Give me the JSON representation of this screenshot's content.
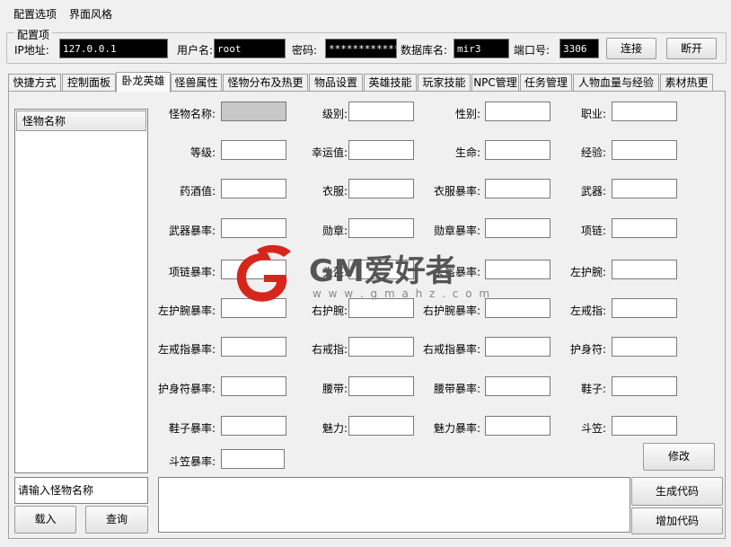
{
  "menu": {
    "config_options": "配置选项",
    "ui_style": "界面风格"
  },
  "config_group": {
    "title": "配置项",
    "ip_label": "IP地址:",
    "ip_value": "127.0.0.1",
    "user_label": "用户名:",
    "user_value": "root",
    "password_label": "密码:",
    "password_value": "**************",
    "db_label": "数据库名:",
    "db_value": "mir3",
    "port_label": "端口号:",
    "port_value": "3306",
    "connect": "连接",
    "disconnect": "断开"
  },
  "tabs": [
    "快捷方式",
    "控制面板",
    "卧龙英雄",
    "怪兽属性",
    "怪物分布及热更",
    "物品设置",
    "英雄技能",
    "玩家技能",
    "NPC管理",
    "任务管理",
    "人物血量与经验",
    "素材热更"
  ],
  "active_tab": 2,
  "list": {
    "header": "怪物名称",
    "search_placeholder": "请输入怪物名称",
    "load": "载入",
    "query": "查询"
  },
  "fields": {
    "name": "怪物名称:",
    "level": "级别:",
    "gender": "性别:",
    "job": "职业:",
    "grade": "等级:",
    "luck": "幸运值:",
    "hp": "生命:",
    "exp": "经验:",
    "wine": "药酒值:",
    "clothes": "衣服:",
    "clothes_rate": "衣服暴率:",
    "weapon": "武器:",
    "weapon_rate": "武器暴率:",
    "medal": "勋章:",
    "medal_rate": "勋章暴率:",
    "necklace": "项链:",
    "necklace_rate": "项链暴率:",
    "helmet": "头盔:",
    "helmet_rate": "头盔暴率:",
    "lbracelet": "左护腕:",
    "lbracelet_rate": "左护腕暴率:",
    "rbracelet": "右护腕:",
    "rbracelet_rate": "右护腕暴率:",
    "lring": "左戒指:",
    "lring_rate": "左戒指暴率:",
    "rring": "右戒指:",
    "rring_rate": "右戒指暴率:",
    "amulet": "护身符:",
    "amulet_rate": "护身符暴率:",
    "belt": "腰带:",
    "belt_rate": "腰带暴率:",
    "shoes": "鞋子:",
    "shoes_rate": "鞋子暴率:",
    "charm": "魅力:",
    "charm_rate": "魅力暴率:",
    "hat": "斗笠:",
    "hat_rate": "斗笠暴率:"
  },
  "buttons": {
    "modify": "修改",
    "generate": "生成代码",
    "add": "增加代码"
  },
  "watermark": {
    "text": "GM爱好者",
    "url": "w w w . g m a h z . c o m"
  }
}
